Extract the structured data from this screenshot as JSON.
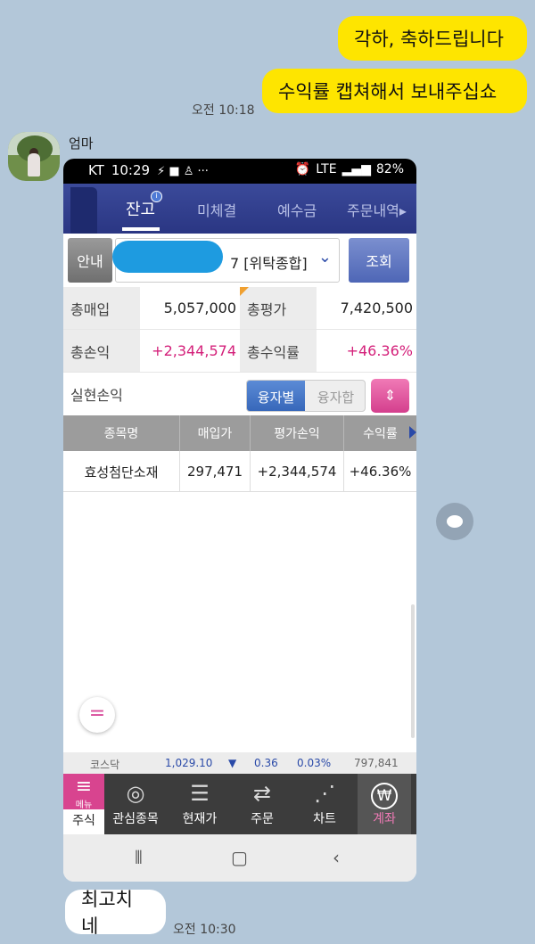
{
  "chat": {
    "msg1": "각하, 축하드립니다",
    "msg2": "수익률 캡쳐해서 보내주십쇼",
    "time1": "오전 10:18",
    "sender": "엄마",
    "reply": "최고치네",
    "time2": "오전 10:30"
  },
  "status_bar": {
    "carrier": "KT",
    "time": "10:29",
    "network": "LTE",
    "battery": "82%"
  },
  "app": {
    "tabs": [
      "잔고",
      "미체결",
      "예수금",
      "주문내역▸"
    ],
    "info_button": "안내",
    "account_suffix": "7",
    "account_type": "[위탁종합]",
    "query_button": "조회",
    "summary": {
      "total_buy_label": "총매입",
      "total_buy": "5,057,000",
      "total_eval_label": "총평가",
      "total_eval": "7,420,500",
      "total_pnl_label": "총손익",
      "total_pnl": "+2,344,574",
      "total_return_label": "총수익률",
      "total_return": "+46.36%",
      "realized_label": "실현손익",
      "realized": ""
    },
    "segment": {
      "on": "융자별",
      "off": "융자합"
    },
    "table": {
      "headers": [
        "종목명",
        "매입가",
        "평가손익",
        "수익률"
      ],
      "rows": [
        {
          "name": "효성첨단소재",
          "buy_price": "297,471",
          "pnl": "+2,344,574",
          "return": "+46.36%"
        }
      ]
    },
    "ticker": {
      "name": "코스닥",
      "index": "1,029.10",
      "change": "0.36",
      "change_pct": "0.03%",
      "volume": "797,841"
    },
    "bottom_tabs": {
      "menu_small": "메뉴",
      "menu": "주식",
      "watch": "관심종목",
      "current": "현재가",
      "order": "주문",
      "chart": "차트",
      "account": "계좌"
    }
  },
  "colors": {
    "chat_bg": "#b3c7d9",
    "my_bubble": "#fee500",
    "app_header": "#2a3683",
    "positive": "#d4207a"
  }
}
